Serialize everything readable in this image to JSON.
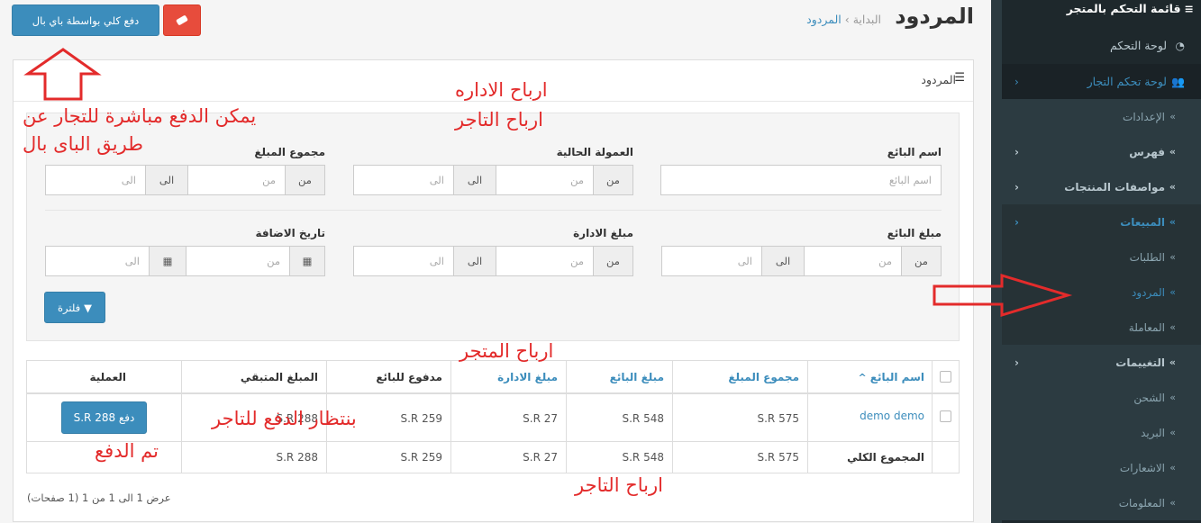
{
  "sidebar": {
    "header": "قائمة التحكم بالمتجر",
    "items": [
      {
        "label": "لوحة التحكم",
        "icon": "dashboard-icon"
      },
      {
        "label": "لوحة تحكم التجار",
        "icon": "users-icon"
      }
    ],
    "sub_items": [
      {
        "label": "الإعدادات"
      },
      {
        "label": "فهرس"
      },
      {
        "label": "مواصفات المنتجات"
      },
      {
        "label": "المبيعات"
      },
      {
        "label": "الطلبات"
      },
      {
        "label": "المردود"
      },
      {
        "label": "المعاملة"
      },
      {
        "label": "التغييمات"
      },
      {
        "label": "الشحن"
      },
      {
        "label": "البريد"
      },
      {
        "label": "الاشعارات"
      },
      {
        "label": "المعلومات"
      }
    ]
  },
  "header": {
    "title": "المردود",
    "breadcrumb_home": "البداية",
    "breadcrumb_current": "المردود",
    "paypal_button": "دفع كلي بواسطة باي بال"
  },
  "panel": {
    "title": "المردود",
    "filters": {
      "seller_name_label": "اسم البائع",
      "seller_name_placeholder": "اسم البائع",
      "commission_label": "العمولة الحالية",
      "total_label": "مجموع المبلغ",
      "seller_amount_label": "مبلغ البائع",
      "admin_amount_label": "مبلغ الادارة",
      "date_added_label": "تاريخ الاضافة",
      "from_addon": "من",
      "to_addon": "الى",
      "from_placeholder": "من",
      "to_placeholder": "الى",
      "filter_button": "فلترة"
    },
    "table": {
      "headers": [
        "اسم البائع",
        "مجموع المبلغ",
        "مبلغ البائع",
        "مبلغ الادارة",
        "مدفوع للبائع",
        "المبلغ المتبقي",
        "العملية"
      ],
      "sort_indicator": "^",
      "rows": [
        {
          "seller": "demo demo",
          "total": "S.R 575",
          "seller_amount": "S.R 548",
          "admin_amount": "S.R 27",
          "paid": "S.R 259",
          "remaining": "S.R 288",
          "action": "دفع S.R 288"
        }
      ],
      "footer": {
        "label": "المجموع الكلي",
        "total": "S.R 575",
        "seller_amount": "S.R 548",
        "admin_amount": "S.R 27",
        "paid": "S.R 259",
        "remaining": "S.R 288"
      }
    },
    "pagination": "عرض 1 الى 1 من 1 (1 صفحات)"
  },
  "annotations": {
    "paypal_note_line1": "يمكن الدفع مباشرة للتجار عن",
    "paypal_note_line2": "طريق الباى بال",
    "admin_profits": "ارباح الاداره",
    "merchant_profits_top": "ارباح التاجر",
    "store_profits": "ارباح المتجر",
    "awaiting_payment": "بنتظار الدفع للتاجر",
    "paid": "تم الدفع",
    "merchant_profits_bottom": "ارباح التاجر"
  },
  "colors": {
    "accent": "#3c8dbc",
    "danger": "#e74c3c",
    "sidebar": "#1e282c",
    "annotation": "#e32b2b"
  }
}
